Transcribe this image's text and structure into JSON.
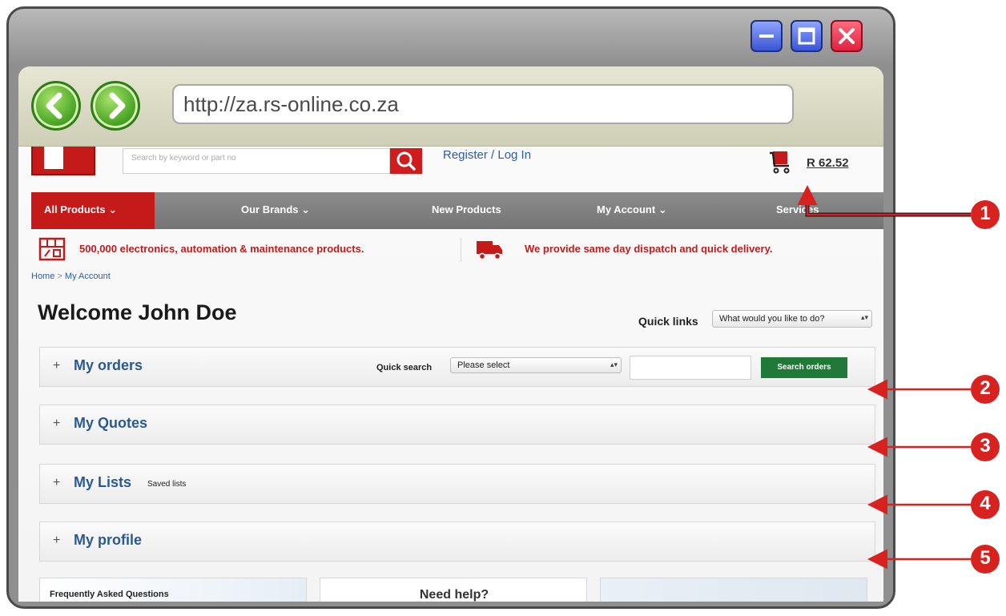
{
  "browser": {
    "url": "http://za.rs-online.co.za",
    "window_controls": {
      "minimize_icon": "minimize-icon",
      "maximize_icon": "maximize-icon",
      "close_icon": "close-icon"
    },
    "back_icon": "back-arrow-icon",
    "forward_icon": "forward-arrow-icon"
  },
  "header": {
    "search_placeholder": "Search by keyword or part no",
    "register_label": "Register / Log In",
    "cart_total": "R 62.52"
  },
  "navbar": {
    "all_products": "All Products",
    "our_brands": "Our Brands",
    "new_products": "New Products",
    "my_account": "My Account",
    "services": "Services"
  },
  "promos": [
    "500,000 electronics, automation & maintenance products.",
    "We provide same day dispatch and quick delivery."
  ],
  "breadcrumb": {
    "home": "Home",
    "separator": ">",
    "current": "My Account"
  },
  "account": {
    "welcome": "Welcome John Doe",
    "quick_links_label": "Quick links",
    "quick_links_value": "What would you like to do?"
  },
  "sections": {
    "orders": {
      "title": "My orders",
      "quick_search_label": "Quick search",
      "quick_search_value": "Please select",
      "search_button": "Search orders"
    },
    "quotes": {
      "title": "My Quotes"
    },
    "lists": {
      "title": "My Lists",
      "subtitle": "Saved lists"
    },
    "profile": {
      "title": "My profile"
    },
    "plus": "+"
  },
  "footer": {
    "faq": "Frequently Asked Questions",
    "need_help": "Need help?"
  },
  "callouts": [
    "1",
    "2",
    "3",
    "4",
    "5"
  ],
  "colors": {
    "brand_red": "#c41a1a",
    "callout_red": "#d7221f",
    "link_blue": "#2a5ca8",
    "section_title": "#2a5a94",
    "search_green": "#1f7a38"
  }
}
